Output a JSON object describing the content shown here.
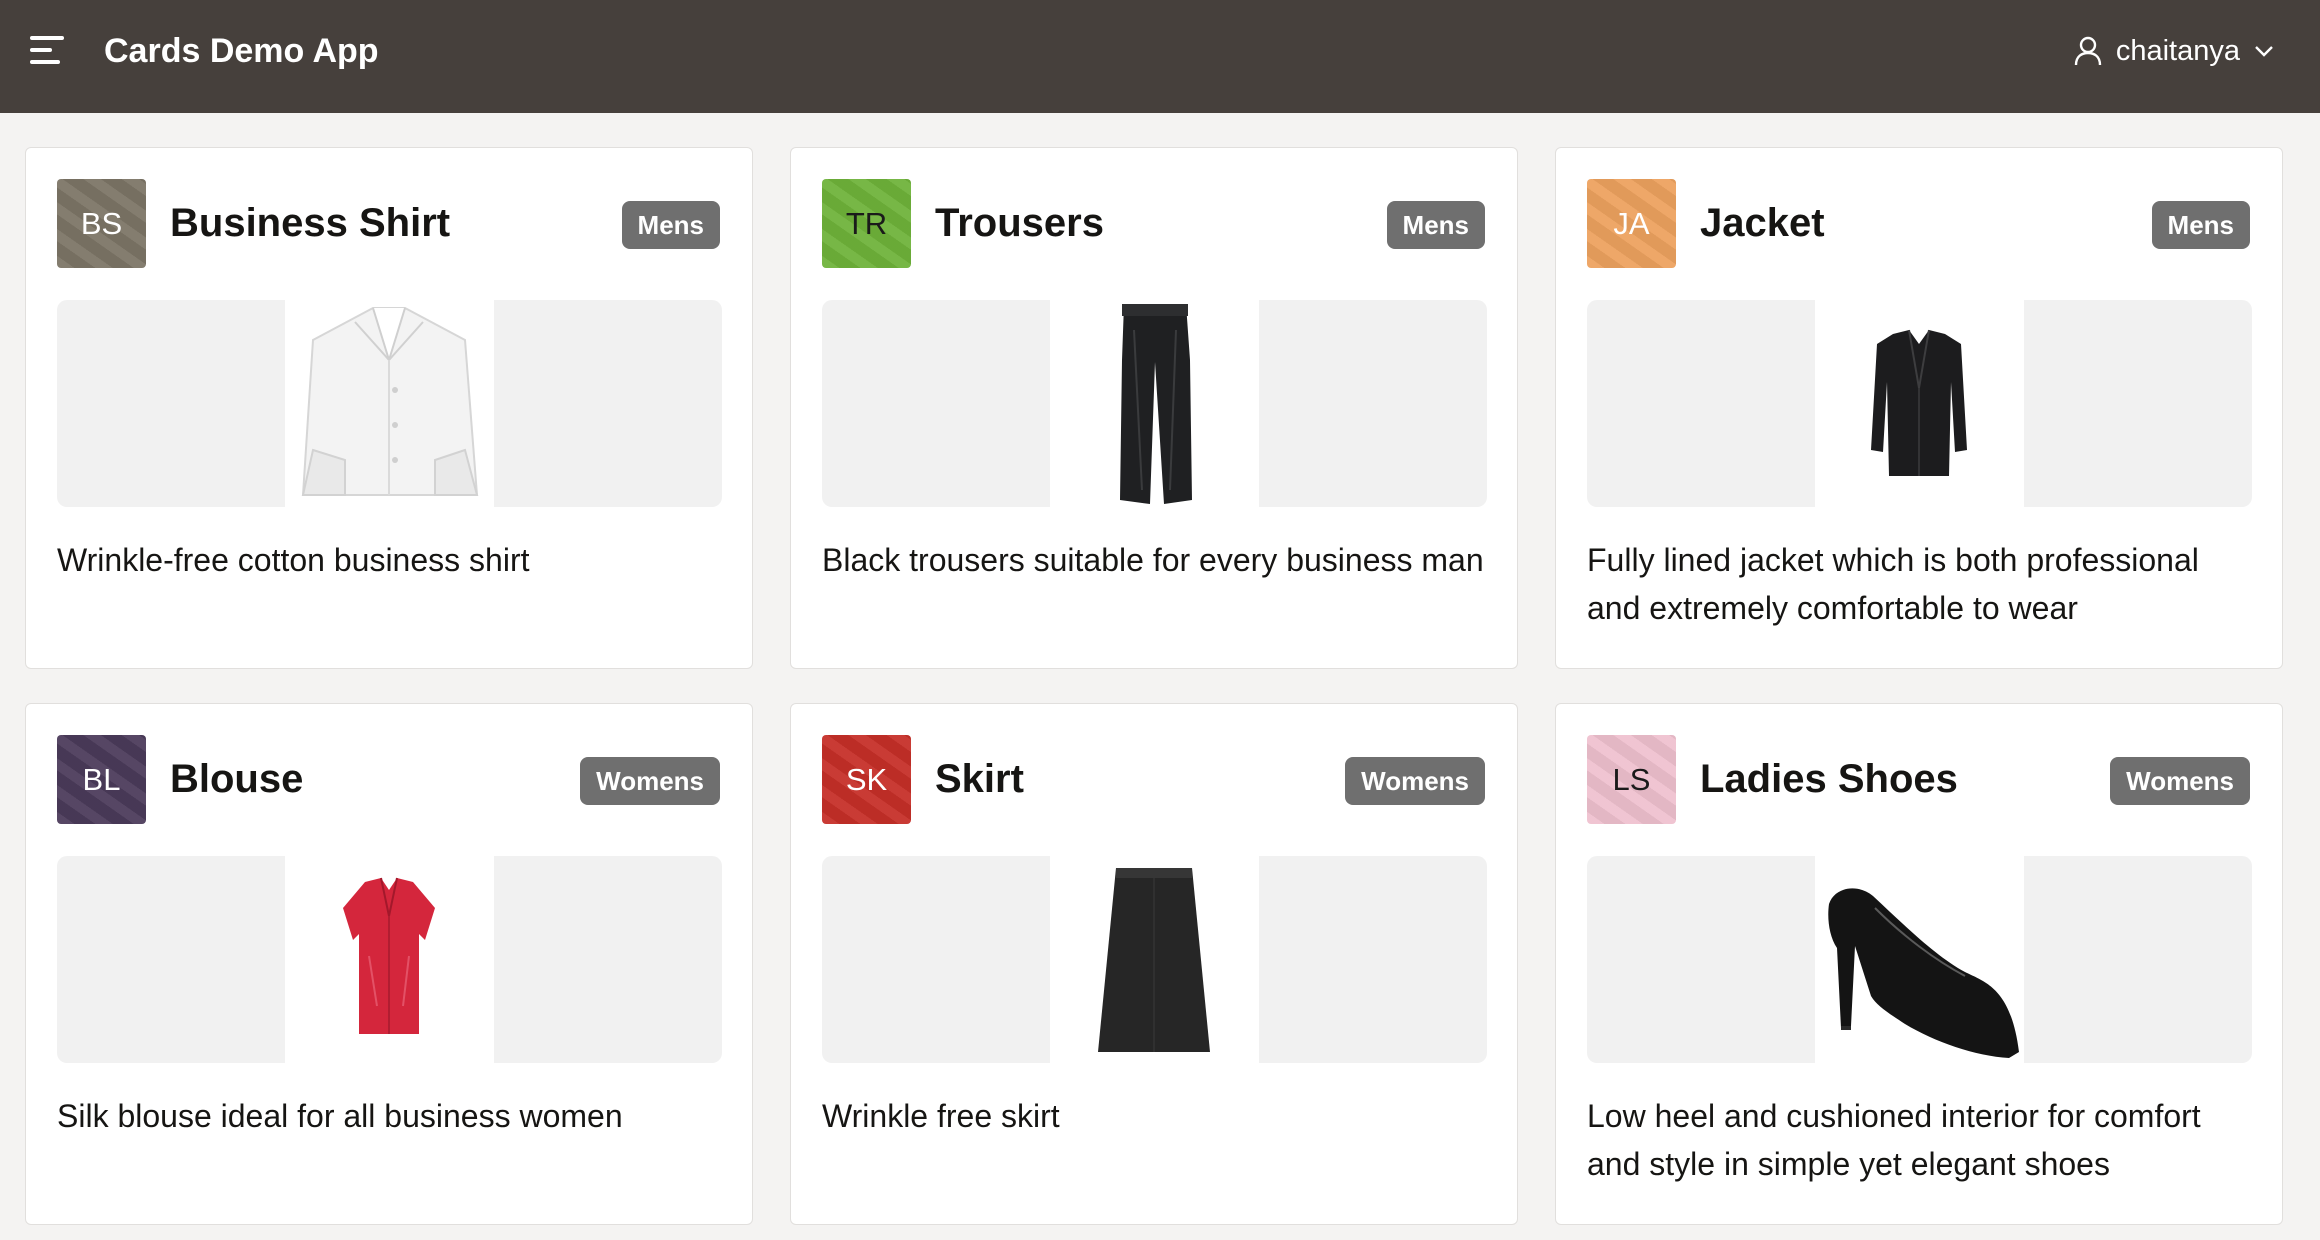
{
  "header": {
    "app_title": "Cards Demo App",
    "user_name": "chaitanya",
    "menu_icon": "hamburger-menu-icon",
    "user_icon": "user-icon",
    "dropdown_icon": "chevron-down-icon"
  },
  "cards": [
    {
      "initials": "BS",
      "title": "Business Shirt",
      "badge": "Mens",
      "description": "Wrinkle-free cotton business shirt",
      "avatar_color": "#7c7566",
      "image": "shirt-image"
    },
    {
      "initials": "TR",
      "title": "Trousers",
      "badge": "Mens",
      "description": "Black trousers suitable for every business man",
      "avatar_color": "#6fb33a",
      "image": "trousers-image"
    },
    {
      "initials": "JA",
      "title": "Jacket",
      "badge": "Mens",
      "description": "Fully lined jacket which is both professional and extremely comfortable to wear",
      "avatar_color": "#eda25f",
      "image": "jacket-image"
    },
    {
      "initials": "BL",
      "title": "Blouse",
      "badge": "Womens",
      "description": "Silk blouse ideal for all business women",
      "avatar_color": "#4b3b5a",
      "image": "blouse-image"
    },
    {
      "initials": "SK",
      "title": "Skirt",
      "badge": "Womens",
      "description": "Wrinkle free skirt",
      "avatar_color": "#c62f28",
      "image": "skirt-image"
    },
    {
      "initials": "LS",
      "title": "Ladies Shoes",
      "badge": "Womens",
      "description": "Low heel and cushioned interior for comfort and style in simple yet elegant shoes",
      "avatar_color": "#efc1cf",
      "image": "shoes-image"
    }
  ]
}
